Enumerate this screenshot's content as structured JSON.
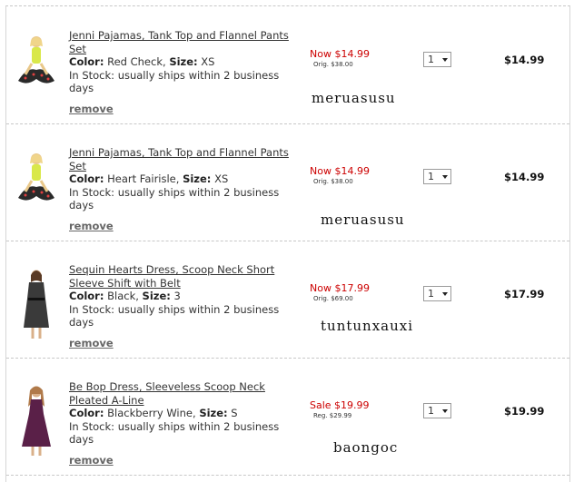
{
  "items": [
    {
      "title": "Jenni Pajamas, Tank Top and Flannel Pants Set",
      "color_label": "Color:",
      "color": "Red Check,",
      "size_label": "Size:",
      "size": "XS",
      "stock": "In Stock: usually ships within 2 business days",
      "remove": "remove",
      "price_now": "Now $14.99",
      "price_orig": "Orig. $38.00",
      "qty": "1",
      "total": "$14.99",
      "overlay": "meruasusu"
    },
    {
      "title": "Jenni Pajamas, Tank Top and Flannel Pants Set",
      "color_label": "Color:",
      "color": "Heart Fairisle,",
      "size_label": "Size:",
      "size": "XS",
      "stock": "In Stock: usually ships within 2 business days",
      "remove": "remove",
      "price_now": "Now $14.99",
      "price_orig": "Orig. $38.00",
      "qty": "1",
      "total": "$14.99",
      "overlay": "meruasusu"
    },
    {
      "title": "Sequin Hearts Dress, Scoop Neck Short Sleeve Shift with Belt",
      "color_label": "Color:",
      "color": "Black,",
      "size_label": "Size:",
      "size": "3",
      "stock": "In Stock: usually ships within 2 business days",
      "remove": "remove",
      "price_now": "Now $17.99",
      "price_orig": "Orig. $69.00",
      "qty": "1",
      "total": "$17.99",
      "overlay": "tuntunxauxi"
    },
    {
      "title": "Be Bop Dress, Sleeveless Scoop Neck Pleated A-Line",
      "color_label": "Color:",
      "color": "Blackberry Wine,",
      "size_label": "Size:",
      "size": "S",
      "stock": "In Stock: usually ships within 2 business days",
      "remove": "remove",
      "price_now": "Sale $19.99",
      "price_orig": "Reg. $29.99",
      "qty": "1",
      "total": "$19.99",
      "overlay": "baongoc"
    }
  ]
}
